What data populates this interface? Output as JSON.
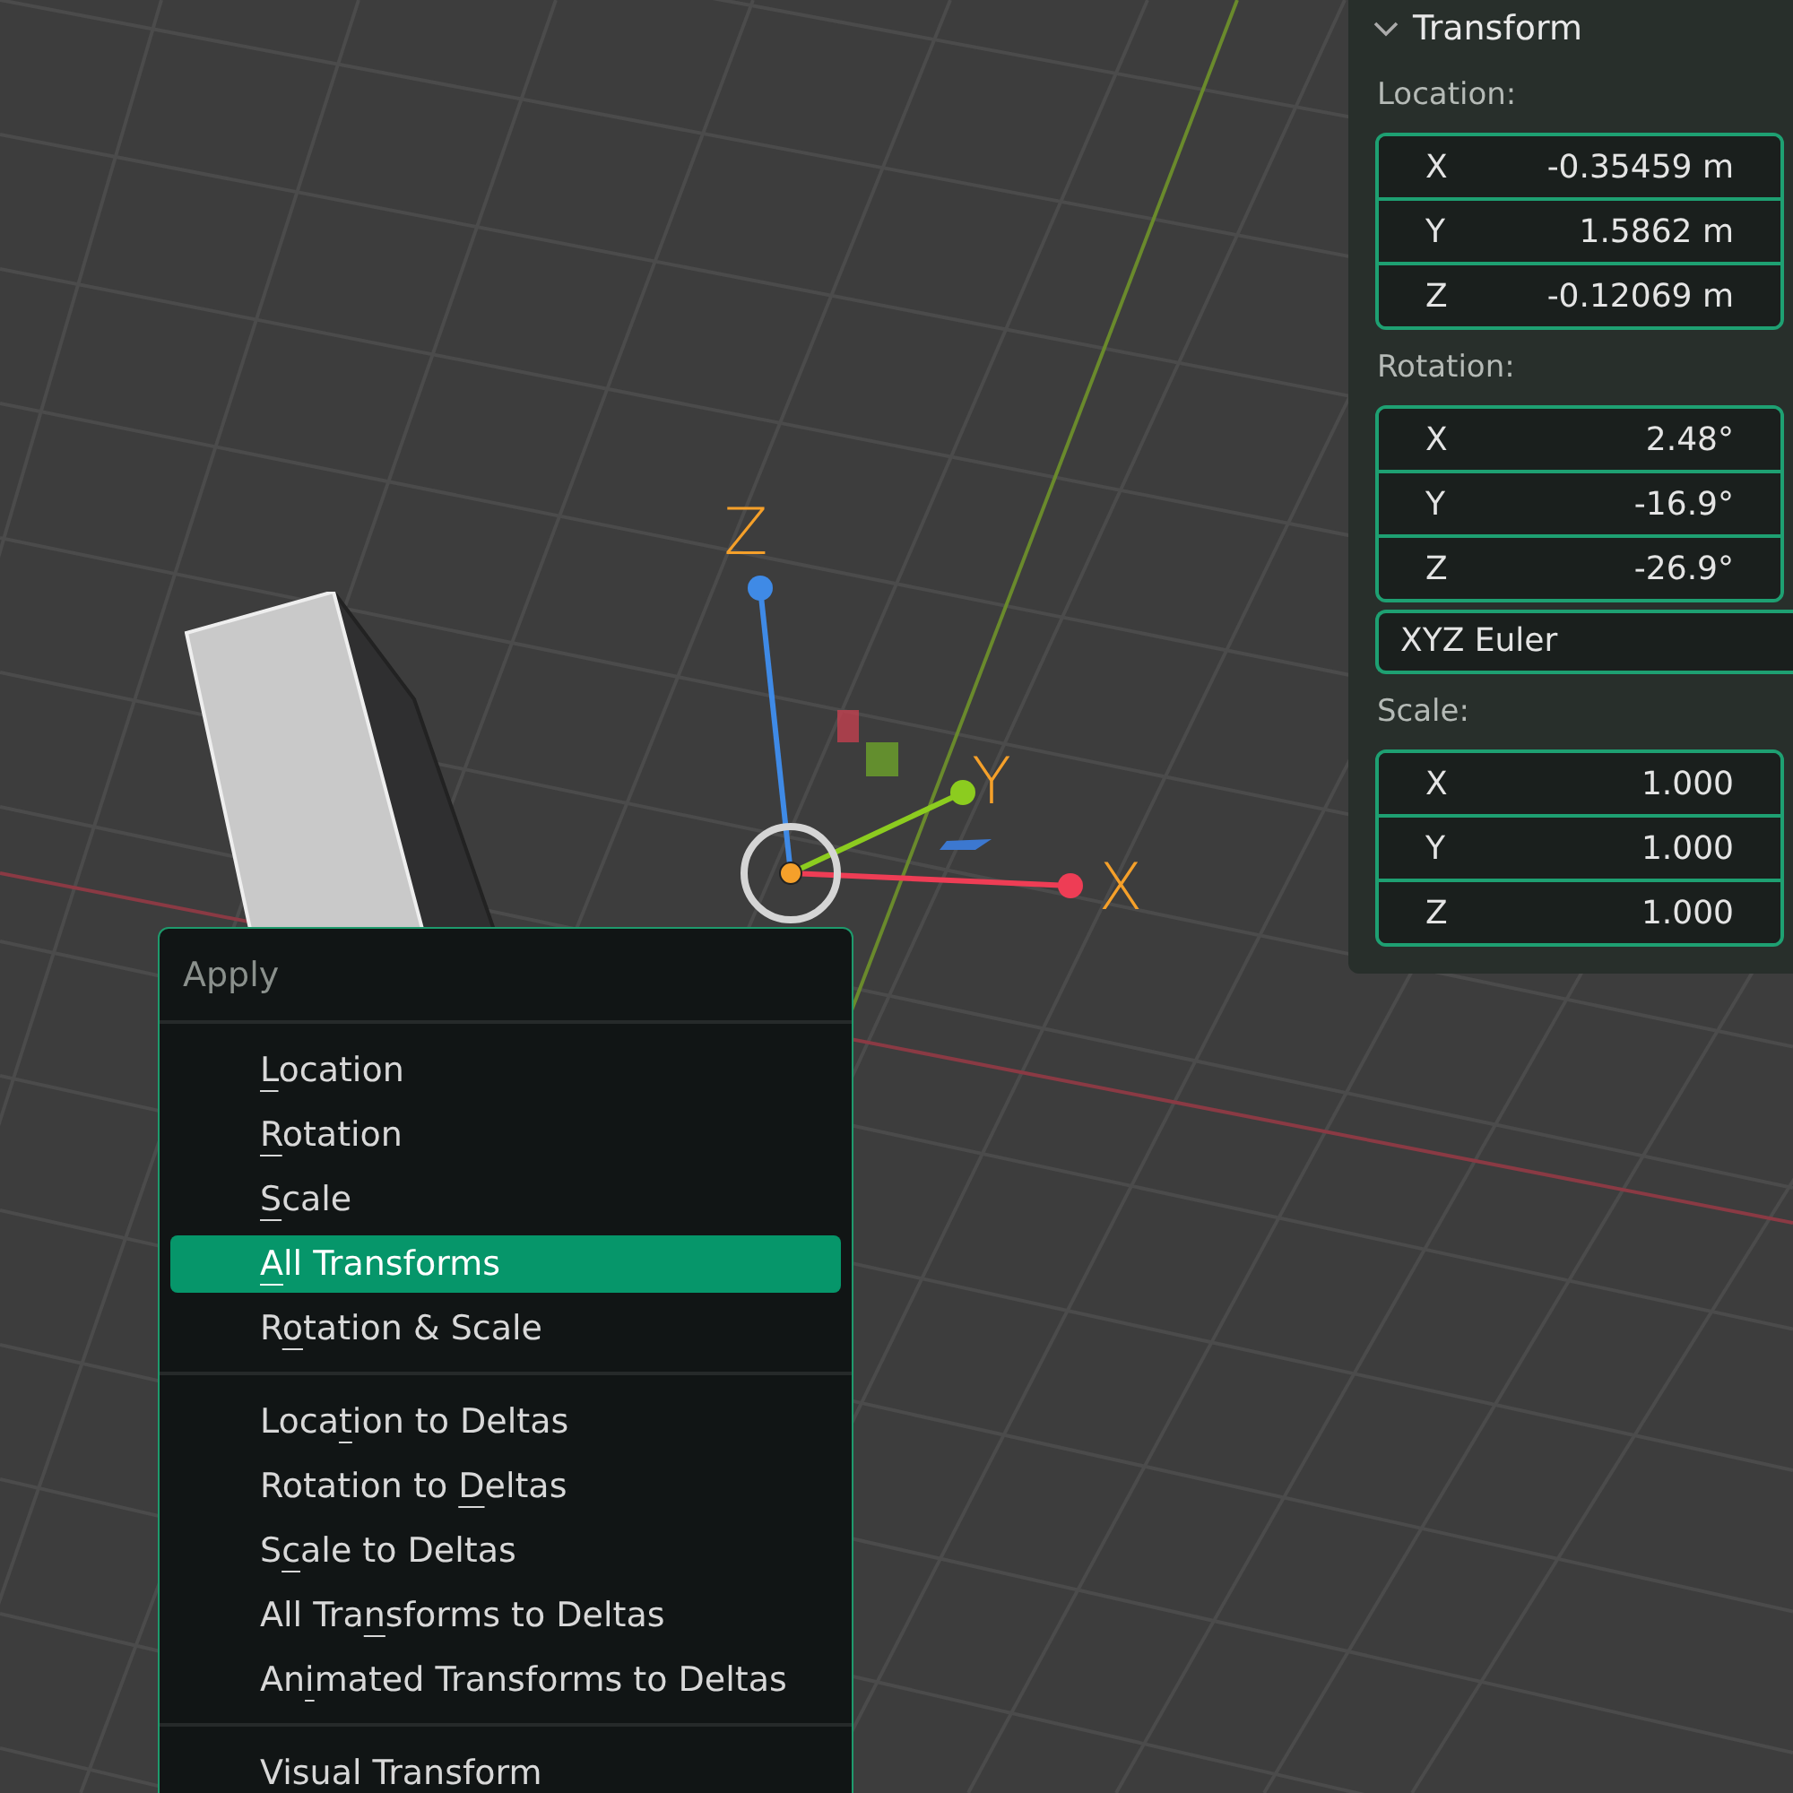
{
  "gizmo": {
    "axes": [
      {
        "label": "Z",
        "color": "#3f8ae6"
      },
      {
        "label": "Y",
        "color": "#8ccc1f"
      },
      {
        "label": "X",
        "color": "#ee3d55"
      }
    ]
  },
  "menu": {
    "title": "Apply",
    "sections": [
      [
        {
          "key": "L",
          "post": "ocation",
          "selected": false
        },
        {
          "key": "R",
          "post": "otation",
          "selected": false
        },
        {
          "key": "S",
          "post": "cale",
          "selected": false
        },
        {
          "key": "A",
          "post": "ll Transforms",
          "selected": true
        },
        {
          "pre": "R",
          "key": "o",
          "post": "tation & Scale",
          "selected": false
        }
      ],
      [
        {
          "pre": "Loca",
          "key": "t",
          "post": "ion to Deltas",
          "selected": false
        },
        {
          "pre": "Rotation to ",
          "key": "D",
          "post": "eltas",
          "selected": false
        },
        {
          "pre": "S",
          "key": "c",
          "post": "ale to Deltas",
          "selected": false
        },
        {
          "pre": "All Tra",
          "key": "n",
          "post": "sforms to Deltas",
          "selected": false
        },
        {
          "pre": "An",
          "key": "i",
          "post": "mated Transforms to Deltas",
          "selected": false
        }
      ],
      [
        {
          "key": "V",
          "post": "isual Transform",
          "selected": false
        }
      ]
    ]
  },
  "panel": {
    "title": "Transform",
    "expanded": true,
    "groups": [
      {
        "kind": "fields",
        "label": "Location:",
        "rows": [
          {
            "axis": "X",
            "value": "-0.35459 m"
          },
          {
            "axis": "Y",
            "value": "1.5862 m"
          },
          {
            "axis": "Z",
            "value": "-0.12069 m"
          }
        ]
      },
      {
        "kind": "fields",
        "label": "Rotation:",
        "rows": [
          {
            "axis": "X",
            "value": "2.48°"
          },
          {
            "axis": "Y",
            "value": "-16.9°"
          },
          {
            "axis": "Z",
            "value": "-26.9°"
          }
        ]
      },
      {
        "kind": "dropdown",
        "value": "XYZ Euler"
      },
      {
        "kind": "fields",
        "label": "Scale:",
        "rows": [
          {
            "axis": "X",
            "value": "1.000"
          },
          {
            "axis": "Y",
            "value": "1.000"
          },
          {
            "axis": "Z",
            "value": "1.000"
          }
        ]
      }
    ]
  }
}
